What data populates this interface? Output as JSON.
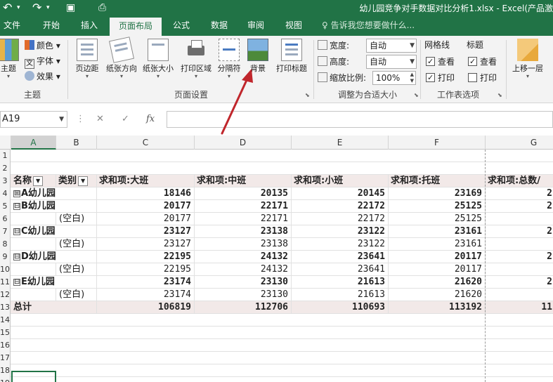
{
  "window": {
    "title": "幼儿园竞争对手数据对比分析1.xlsx - Excel(产品激",
    "qat_icons": [
      "undo-icon",
      "redo-icon",
      "save-icon",
      "print-preview-icon"
    ]
  },
  "tabs": [
    {
      "label": "文件"
    },
    {
      "label": "开始"
    },
    {
      "label": "插入"
    },
    {
      "label": "页面布局",
      "active": true
    },
    {
      "label": "公式"
    },
    {
      "label": "数据"
    },
    {
      "label": "审阅"
    },
    {
      "label": "视图"
    }
  ],
  "tellme": {
    "text": "告诉我您想要做什么..."
  },
  "ribbon": {
    "themes": {
      "theme_label": "主题",
      "colors_label": "颜色",
      "fonts_label": "字体",
      "effects_label": "效果",
      "group_label": "主题"
    },
    "page_setup": {
      "margins": "页边距",
      "orientation": "纸张方向",
      "size": "纸张大小",
      "print_area": "打印区域",
      "breaks": "分隔符",
      "background": "背景",
      "print_titles": "打印标题",
      "group_label": "页面设置"
    },
    "scale_to_fit": {
      "width_label": "宽度:",
      "width_value": "自动",
      "height_label": "高度:",
      "height_value": "自动",
      "scale_label": "缩放比例:",
      "scale_value": "100%",
      "group_label": "调整为合适大小"
    },
    "sheet_options": {
      "gridlines": "网格线",
      "headings": "标题",
      "view": "查看",
      "print": "打印",
      "group_label": "工作表选项",
      "gridlines_view": true,
      "gridlines_print": true,
      "headings_view": true,
      "headings_print": false
    },
    "arrange": {
      "bring_forward": "上移一层"
    }
  },
  "formula_bar": {
    "name_box": "A19",
    "cancel": "✕",
    "enter": "✓",
    "fx": "fx",
    "value": ""
  },
  "sheet": {
    "columns": [
      "A",
      "B",
      "C",
      "D",
      "E",
      "F",
      "G"
    ],
    "selected_column": "A",
    "row_numbers": [
      "1",
      "2",
      "3",
      "4",
      "5",
      "6",
      "7",
      "8",
      "9",
      "10",
      "11",
      "12",
      "13",
      "14",
      "15",
      "16",
      "17",
      "18",
      "19"
    ],
    "headers": [
      "名称",
      "类别",
      "求和项:大班",
      "求和项:中班",
      "求和项:小班",
      "求和项:托班",
      "求和项:总数/"
    ],
    "rows": [
      {
        "name": "A幼儿园",
        "category": "",
        "values": [
          "18146",
          "20135",
          "20145",
          "23169",
          "2"
        ],
        "kind": "group",
        "expander": "⊞"
      },
      {
        "name": "B幼儿园",
        "category": "",
        "values": [
          "20177",
          "22171",
          "22172",
          "25125",
          "2"
        ],
        "kind": "group",
        "expander": "⊟"
      },
      {
        "name": "",
        "category": "(空白)",
        "values": [
          "20177",
          "22171",
          "22172",
          "25125",
          ""
        ],
        "kind": "detail"
      },
      {
        "name": "C幼儿园",
        "category": "",
        "values": [
          "23127",
          "23138",
          "23122",
          "23161",
          "2"
        ],
        "kind": "group",
        "expander": "⊟"
      },
      {
        "name": "",
        "category": "(空白)",
        "values": [
          "23127",
          "23138",
          "23122",
          "23161",
          ""
        ],
        "kind": "detail"
      },
      {
        "name": "D幼儿园",
        "category": "",
        "values": [
          "22195",
          "24132",
          "23641",
          "20117",
          "2"
        ],
        "kind": "group",
        "expander": "⊟"
      },
      {
        "name": "",
        "category": "(空白)",
        "values": [
          "22195",
          "24132",
          "23641",
          "20117",
          ""
        ],
        "kind": "detail"
      },
      {
        "name": "E幼儿园",
        "category": "",
        "values": [
          "23174",
          "23130",
          "21613",
          "21620",
          "2"
        ],
        "kind": "group",
        "expander": "⊟"
      },
      {
        "name": "",
        "category": "(空白)",
        "values": [
          "23174",
          "23130",
          "21613",
          "21620",
          ""
        ],
        "kind": "detail"
      }
    ],
    "total": {
      "name": "总计",
      "values": [
        "106819",
        "112706",
        "110693",
        "113192",
        "11"
      ]
    }
  },
  "colors": {
    "excel_green": "#217346",
    "pivot_header_bg": "#f2e9e8",
    "arrow": "#c0262c"
  }
}
